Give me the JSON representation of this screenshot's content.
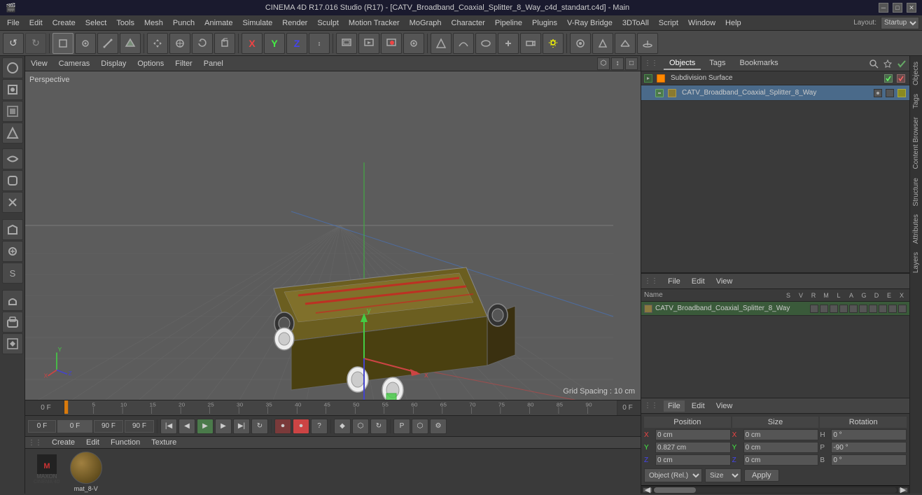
{
  "titlebar": {
    "title": "CINEMA 4D R17.016 Studio (R17) - [CATV_Broadband_Coaxial_Splitter_8_Way_c4d_standart.c4d] - Main",
    "icon": "cinema4d-icon"
  },
  "menubar": {
    "items": [
      "File",
      "Edit",
      "Create",
      "Select",
      "Tools",
      "Mesh",
      "Punch",
      "Animate",
      "Simulate",
      "Render",
      "Sculpt",
      "Motion Tracker",
      "MoGraph",
      "Character",
      "Pipeline",
      "Plugins",
      "V-Ray Bridge",
      "3DToAll",
      "Script",
      "Window",
      "Help"
    ]
  },
  "toolbar": {
    "undo_label": "↺",
    "redo_label": "↻",
    "move_label": "✛",
    "scale_label": "⬡",
    "rotate_label": "↻",
    "transform_label": "+",
    "x_label": "X",
    "y_label": "Y",
    "z_label": "Z",
    "layout_label": "Layout:",
    "layout_value": "Startup"
  },
  "viewport": {
    "perspective_label": "Perspective",
    "grid_spacing": "Grid Spacing : 10 cm",
    "menu_items": [
      "View",
      "Cameras",
      "Display",
      "Options",
      "Filter",
      "Panel"
    ]
  },
  "timeline": {
    "ticks": [
      "0",
      "5",
      "10",
      "15",
      "20",
      "25",
      "30",
      "35",
      "40",
      "45",
      "50",
      "55",
      "60",
      "65",
      "70",
      "75",
      "80",
      "85",
      "90"
    ],
    "of_label": "0 F"
  },
  "playback": {
    "frame_start": "0 F",
    "frame_current": "0 F",
    "frame_end": "90 F",
    "frame_end2": "90 F",
    "max_frame": "0 F"
  },
  "objects_panel": {
    "tabs": [
      "Objects",
      "Tags",
      "Bookmarks"
    ],
    "search_placeholder": "🔍",
    "items": [
      {
        "name": "Subdivision Surface",
        "type": "subdiv",
        "checked": true
      },
      {
        "name": "CATV_Broadband_Coaxial_Splitter_8_Way",
        "type": "object",
        "icon_color": "#ffa500"
      }
    ]
  },
  "obj_list_panel": {
    "tabs": [
      "File",
      "Edit",
      "View"
    ],
    "columns": {
      "name": "Name",
      "flags": [
        "S",
        "V",
        "R",
        "M",
        "L",
        "A",
        "G",
        "D",
        "E",
        "X"
      ]
    },
    "items": [
      {
        "name": "CATV_Broadband_Coaxial_Splitter_8_Way",
        "type": "mesh",
        "selected": true
      }
    ]
  },
  "properties": {
    "tabs": [
      "File",
      "Edit",
      "View"
    ],
    "sections": {
      "position": {
        "label": "Position",
        "x_label": "X",
        "x_value": "0 cm",
        "y_label": "Y",
        "y_value": "0.827 cm",
        "z_label": "Z",
        "z_value": "0 cm"
      },
      "size": {
        "label": "Size",
        "x_label": "X",
        "x_value": "0 cm",
        "y_label": "Y",
        "y_value": "0 cm",
        "z_label": "Z",
        "z_value": "0 cm"
      },
      "rotation": {
        "label": "Rotation",
        "h_label": "H",
        "h_value": "0 °",
        "p_label": "P",
        "p_value": "-90 °",
        "b_label": "B",
        "b_value": "0 °"
      }
    },
    "coord_system": "Object (Rel.)",
    "size_mode": "Size",
    "apply_label": "Apply"
  },
  "materials": {
    "tabs": [
      "Create",
      "Edit",
      "Function",
      "Texture"
    ],
    "items": [
      {
        "name": "mat_8-V",
        "preview_type": "sphere"
      }
    ]
  },
  "right_vtabs": [
    "Objects",
    "Tags",
    "Content Browser",
    "Structure",
    "Attributes",
    "Layers"
  ]
}
